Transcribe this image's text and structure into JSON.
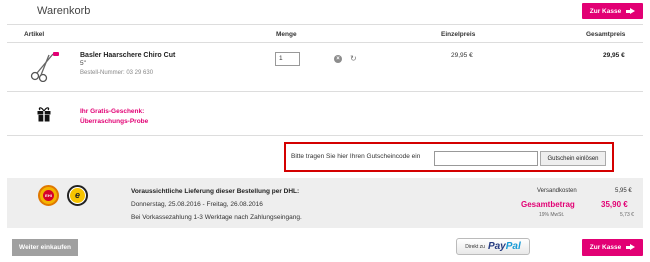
{
  "header": {
    "title": "Warenkorb",
    "checkout_top_label": "Zur Kasse"
  },
  "table": {
    "columns": {
      "article": "Artikel",
      "quantity": "Menge",
      "unit_price": "Einzelpreis",
      "total_price": "Gesamtpreis"
    }
  },
  "item": {
    "name": "Basler Haarschere Chiro Cut",
    "size": "5\"",
    "article_number": "Bestell-Nummer: 03 29 630",
    "quantity": "1",
    "unit_price": "29,95 €",
    "total_price": "29,95 €"
  },
  "gift": {
    "line1": "Ihr Gratis-Geschenk:",
    "line2": "Überraschungs-Probe"
  },
  "voucher": {
    "label": "Bitte tragen Sie hier Ihren Gutscheincode ein",
    "button": "Gutschein einlösen",
    "input_value": ""
  },
  "delivery": {
    "title": "Voraussichtliche Lieferung dieser Bestellung per DHL:",
    "date": "Donnerstag, 25.08.2016 - Freitag, 26.08.2016",
    "note": "Bei Vorkassezahlung 1-3 Werktage nach Zahlungseingang.",
    "badge1_text": "EHI",
    "badge2_text": "e"
  },
  "summary": {
    "shipping_label": "Versandkosten",
    "shipping_value": "5,95 €",
    "total_label": "Gesamtbetrag",
    "total_value": "35,90 €",
    "vat_label": "19% MwSt.",
    "vat_value": "5,73 €"
  },
  "footer": {
    "continue_label": "Weiter einkaufen",
    "paypal_prefix": "Direkt zu",
    "paypal_logo_a": "Pay",
    "paypal_logo_b": "Pal",
    "checkout_bottom_label": "Zur Kasse"
  },
  "colors": {
    "accent": "#e20074",
    "highlight_border": "#d40000",
    "paypal_dark": "#253b80",
    "paypal_light": "#179bd7"
  },
  "icons": [
    "scissors-icon",
    "remove-icon",
    "refresh-icon",
    "gift-icon",
    "arrow-right-icon"
  ]
}
